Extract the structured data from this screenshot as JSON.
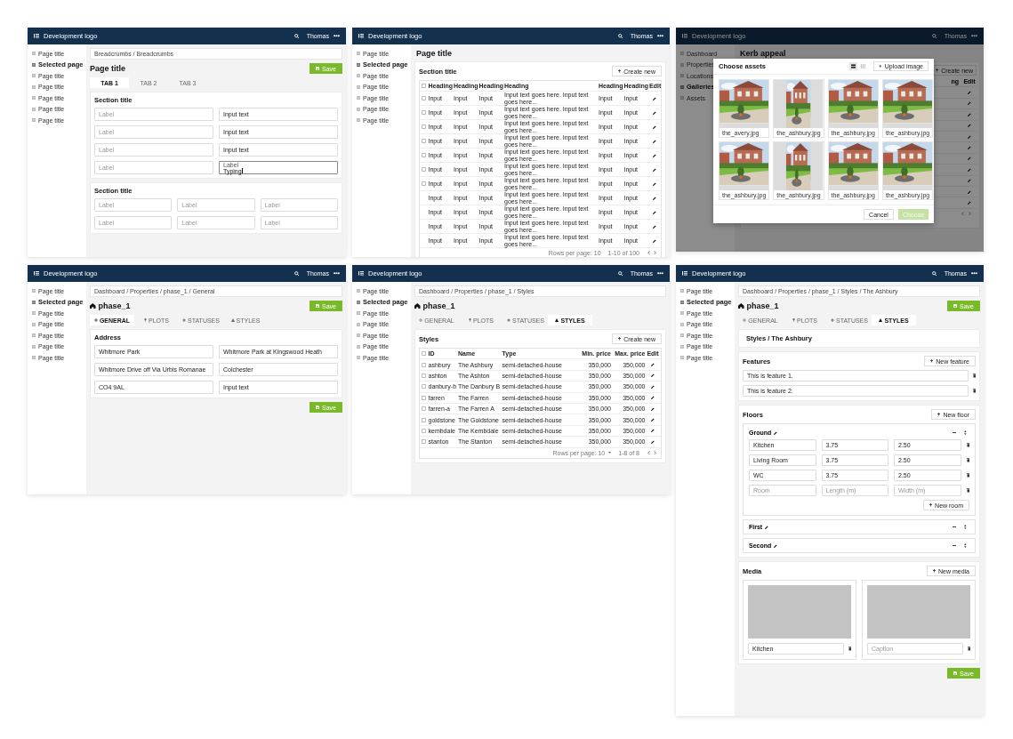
{
  "screens": [
    {
      "kind": "form",
      "header": {
        "logo": "Development logo",
        "user": "Thomas"
      },
      "sidebar": [
        {
          "label": "Page title",
          "selected": false
        },
        {
          "label": "Selected page",
          "selected": true
        },
        {
          "label": "Page title",
          "selected": false
        },
        {
          "label": "Page title",
          "selected": false
        },
        {
          "label": "Page title",
          "selected": false
        },
        {
          "label": "Page title",
          "selected": false
        },
        {
          "label": "Page title",
          "selected": false
        }
      ],
      "breadcrumbs": "Breadcrumbs / Breadcrumbs",
      "title": "Page title",
      "save_button": "Save",
      "tabs": [
        {
          "label": "TAB 1",
          "selected": true
        },
        {
          "label": "TAB 2",
          "selected": false
        },
        {
          "label": "TAB 3",
          "selected": false
        }
      ],
      "sections": [
        {
          "title": "Section title",
          "kind": "double",
          "fields": [
            {
              "placeholder": "Label"
            },
            {
              "value": "Input text"
            },
            {
              "placeholder": "Label"
            },
            {
              "value": "Input text"
            },
            {
              "placeholder": "Label"
            },
            {
              "value": "Input text"
            },
            {
              "placeholder": "Label"
            },
            {
              "label": "Label",
              "value": "Typing",
              "focused": true
            }
          ]
        },
        {
          "title": "Section title",
          "kind": "triple",
          "fields": [
            {
              "placeholder": "Label"
            },
            {
              "placeholder": "Label"
            },
            {
              "placeholder": "Label"
            },
            {
              "placeholder": "Label"
            },
            {
              "placeholder": "Label"
            },
            {
              "placeholder": "Label"
            }
          ]
        }
      ]
    },
    {
      "kind": "table",
      "header": {
        "logo": "Development logo",
        "user": "Thomas"
      },
      "sidebar": [
        {
          "label": "Page title",
          "selected": false
        },
        {
          "label": "Selected page",
          "selected": true
        },
        {
          "label": "Page title",
          "selected": false
        },
        {
          "label": "Page title",
          "selected": false
        },
        {
          "label": "Page title",
          "selected": false
        },
        {
          "label": "Page title",
          "selected": false
        },
        {
          "label": "Page title",
          "selected": false
        }
      ],
      "title": "Page title",
      "section": {
        "title": "Section title",
        "button": "Create new",
        "table": {
          "select_all_checked": false,
          "columns": [
            "Heading",
            "Heading",
            "Heading",
            "Heading",
            "Heading",
            "Heading",
            "Edit"
          ],
          "rows": [
            {
              "checked": false,
              "cells": [
                "Input",
                "Input",
                "Input",
                "Input text goes here. Input text goes here...",
                "Input",
                "Input"
              ]
            },
            {
              "checked": false,
              "cells": [
                "Input",
                "Input",
                "Input",
                "Input text goes here. Input text goes here...",
                "Input",
                "Input"
              ]
            },
            {
              "checked": false,
              "cells": [
                "Input",
                "Input",
                "Input",
                "Input text goes here. Input text goes here...",
                "Input",
                "Input"
              ]
            },
            {
              "checked": false,
              "cells": [
                "Input",
                "Input",
                "Input",
                "Input text goes here. Input text goes here...",
                "Input",
                "Input"
              ]
            },
            {
              "checked": false,
              "cells": [
                "Input",
                "Input",
                "Input",
                "Input text goes here. Input text goes here...",
                "Input",
                "Input"
              ]
            },
            {
              "checked": false,
              "cells": [
                "Input",
                "Input",
                "Input",
                "Input text goes here. Input text goes here...",
                "Input",
                "Input"
              ]
            },
            {
              "checked": false,
              "cells": [
                "Input",
                "Input",
                "Input",
                "Input text goes here. Input text goes here...",
                "Input",
                "Input"
              ]
            },
            {
              "cells": [
                "Input",
                "Input",
                "Input",
                "Input text goes here. Input text goes here...",
                "Input",
                "Input"
              ]
            },
            {
              "cells": [
                "Input",
                "Input",
                "Input",
                "Input text goes here. Input text goes here...",
                "Input",
                "Input"
              ]
            },
            {
              "cells": [
                "Input",
                "Input",
                "Input",
                "Input text goes here. Input text goes here...",
                "Input",
                "Input"
              ]
            },
            {
              "cells": [
                "Input",
                "Input",
                "Input",
                "Input text goes here. Input text goes here...",
                "Input",
                "Input"
              ]
            }
          ],
          "footer": {
            "rows_per_page": "Rows per page: 10",
            "range": "1-10 of 100"
          }
        }
      }
    },
    {
      "kind": "asset-picker",
      "header": {
        "logo": "Development logo",
        "user": "Thomas"
      },
      "sidebar": [
        {
          "label": "Dashboard",
          "selected": false
        },
        {
          "label": "Properties",
          "selected": false
        },
        {
          "label": "Locations",
          "selected": false
        },
        {
          "label": "Galleries",
          "selected": true
        },
        {
          "label": "Assets",
          "selected": false
        }
      ],
      "title": "Kerb appeal",
      "background_button": "Create new",
      "background_columns": [
        "ng",
        "Edit"
      ],
      "modal": {
        "title": "Choose assets",
        "views": [
          {
            "selected": true
          },
          {
            "selected": false
          }
        ],
        "upload_button": "Upload image",
        "assets": [
          {
            "name": "the_avery.jpg",
            "kind": "wide"
          },
          {
            "name": "the_ashbury.jpg",
            "kind": "portrait"
          },
          {
            "name": "the_ashbury.jpg",
            "kind": "wide"
          },
          {
            "name": "the_ashbury.jpg",
            "kind": "wide"
          },
          {
            "name": "the_ashbury.jpg",
            "kind": "wide"
          },
          {
            "name": "the_ashbury.jpg",
            "kind": "portrait"
          },
          {
            "name": "the_ashbury.jpg",
            "kind": "wide"
          },
          {
            "name": "the_ashbury.jpg",
            "kind": "wide"
          }
        ],
        "buttons": [
          {
            "label": "Cancel",
            "disabled": false
          },
          {
            "label": "Choose",
            "disabled": true
          }
        ]
      }
    },
    {
      "kind": "property-general",
      "header": {
        "logo": "Development logo",
        "user": "Thomas"
      },
      "sidebar": [
        {
          "label": "Page title",
          "selected": false
        },
        {
          "label": "Selected page",
          "selected": true
        },
        {
          "label": "Page title",
          "selected": false
        },
        {
          "label": "Page title",
          "selected": false
        },
        {
          "label": "Page title",
          "selected": false
        },
        {
          "label": "Page title",
          "selected": false
        },
        {
          "label": "Page title",
          "selected": false
        }
      ],
      "breadcrumbs": "Dashboard / Properties / phase_1 / General",
      "title": "phase_1",
      "save_button": "Save",
      "tabs": [
        {
          "label": "GENERAL",
          "selected": true
        },
        {
          "label": "PLOTS",
          "selected": false
        },
        {
          "label": "STATUSES",
          "selected": false
        },
        {
          "label": "STYLES",
          "selected": false
        }
      ],
      "sections": [
        {
          "title": "Address",
          "kind": "double",
          "fields": [
            {
              "value": "Whitmore Park"
            },
            {
              "value": "Whitmore Park at Kingswood Heath"
            },
            {
              "value": "Whitmore Drive off Via Urbis Romanae"
            },
            {
              "value": "Colchester"
            },
            {
              "value": "CO4 9AL"
            },
            {
              "value": "Input text"
            }
          ]
        }
      ],
      "footer_save_button": "Save"
    },
    {
      "kind": "styles-table",
      "header": {
        "logo": "Development logo",
        "user": "Thomas"
      },
      "sidebar": [
        {
          "label": "Page title",
          "selected": false
        },
        {
          "label": "Selected page",
          "selected": true
        },
        {
          "label": "Page title",
          "selected": false
        },
        {
          "label": "Page title",
          "selected": false
        },
        {
          "label": "Page title",
          "selected": false
        },
        {
          "label": "Page title",
          "selected": false
        },
        {
          "label": "Page title",
          "selected": false
        }
      ],
      "breadcrumbs": "Dashboard / Properties / phase_1 / Styles",
      "title": "phase_1",
      "tabs": [
        {
          "label": "GENERAL",
          "selected": false
        },
        {
          "label": "PLOTS",
          "selected": false
        },
        {
          "label": "STATUSES",
          "selected": false
        },
        {
          "label": "STYLES",
          "selected": true
        }
      ],
      "section": {
        "title": "Styles",
        "button": "Create new",
        "table": {
          "select_all_checked": false,
          "columns": [
            "ID",
            "Name",
            "Type",
            "Min. price",
            "Max. price",
            "Edit"
          ],
          "rows": [
            {
              "checked": false,
              "cells": [
                "ashbury",
                "The Ashbury",
                "semi-detached-house",
                "350,000",
                "350,000"
              ]
            },
            {
              "checked": false,
              "cells": [
                "ashton",
                "The Ashton",
                "semi-detached-house",
                "350,000",
                "350,000"
              ]
            },
            {
              "checked": false,
              "cells": [
                "danbury-b",
                "The Danbury B",
                "semi-detached-house",
                "350,000",
                "350,000"
              ]
            },
            {
              "checked": false,
              "cells": [
                "farren",
                "The Farren",
                "semi-detached-house",
                "350,000",
                "350,000"
              ]
            },
            {
              "checked": false,
              "cells": [
                "farren-a",
                "The Farren A",
                "semi-detached-house",
                "350,000",
                "350,000"
              ]
            },
            {
              "checked": false,
              "cells": [
                "goldstone",
                "The Goldstone",
                "semi-detached-house",
                "350,000",
                "350,000"
              ]
            },
            {
              "checked": false,
              "cells": [
                "kembdale",
                "The Kembdale",
                "semi-detached-house",
                "350,000",
                "350,000"
              ]
            },
            {
              "checked": false,
              "cells": [
                "stanton",
                "The Stanton",
                "semi-detached-house",
                "350,000",
                "350,000"
              ]
            }
          ],
          "footer": {
            "rows_per_page": "Rows per page: 10",
            "range": "1-8 of 8"
          }
        }
      }
    },
    {
      "kind": "style-detail",
      "header": {
        "logo": "Development logo",
        "user": "Thomas"
      },
      "sidebar": [
        {
          "label": "Page title",
          "selected": false
        },
        {
          "label": "Selected page",
          "selected": true
        },
        {
          "label": "Page title",
          "selected": false
        },
        {
          "label": "Page title",
          "selected": false
        },
        {
          "label": "Page title",
          "selected": false
        },
        {
          "label": "Page title",
          "selected": false
        },
        {
          "label": "Page title",
          "selected": false
        }
      ],
      "breadcrumbs": "Dashboard / Properties / phase_1 / Styles / The Ashbury",
      "title": "phase_1",
      "save_button": "Save",
      "tabs": [
        {
          "label": "GENERAL",
          "selected": false
        },
        {
          "label": "PLOTS",
          "selected": false
        },
        {
          "label": "STATUSES",
          "selected": false
        },
        {
          "label": "STYLES",
          "selected": true
        }
      ],
      "subtitle": "Styles / The Ashbury",
      "features": {
        "title": "Features",
        "button": "New feature",
        "items": [
          {
            "value": "This is feature 1."
          },
          {
            "value": "This is feature 2."
          }
        ]
      },
      "floors": {
        "title": "Floors",
        "button": "New floor",
        "items": [
          {
            "name": "Ground",
            "expanded": true,
            "add_button": "New room",
            "rooms": [
              {
                "fields": [
                  {
                    "value": "Kitchen"
                  },
                  {
                    "value": "3.75"
                  },
                  {
                    "value": "2.50"
                  }
                ]
              },
              {
                "fields": [
                  {
                    "value": "Living Room"
                  },
                  {
                    "value": "3.75"
                  },
                  {
                    "value": "2.50"
                  }
                ]
              },
              {
                "fields": [
                  {
                    "value": "WC"
                  },
                  {
                    "value": "3.75"
                  },
                  {
                    "value": "2.50"
                  }
                ]
              },
              {
                "fields": [
                  {
                    "placeholder": "Room"
                  },
                  {
                    "placeholder": "Length (m)"
                  },
                  {
                    "placeholder": "Width (m)"
                  }
                ]
              }
            ]
          },
          {
            "name": "First",
            "expanded": false
          },
          {
            "name": "Second",
            "expanded": false
          }
        ]
      },
      "media": {
        "title": "Media",
        "button": "New media",
        "items": [
          {
            "caption": {
              "value": "Kitchen"
            }
          },
          {
            "caption": {
              "placeholder": "Caption"
            }
          }
        ]
      },
      "footer_save_button": "Save"
    }
  ]
}
